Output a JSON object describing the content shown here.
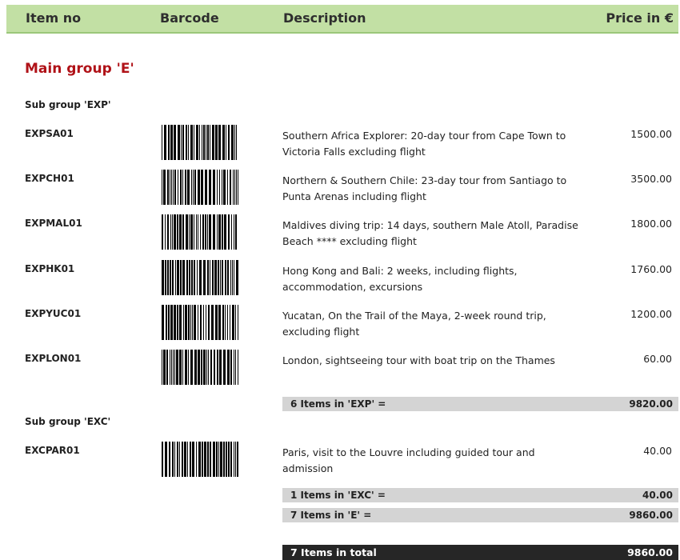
{
  "header": {
    "item_no": "Item no",
    "barcode": "Barcode",
    "description": "Description",
    "price": "Price in €"
  },
  "main_group": "Main group 'E'",
  "subgroups": [
    {
      "title": "Sub group 'EXP'",
      "items": [
        {
          "item_no": "EXPSA01",
          "description": "Southern Africa Explorer: 20-day tour from Cape Town to Victoria Falls excluding flight",
          "price": "1500.00"
        },
        {
          "item_no": "EXPCH01",
          "description": "Northern & Southern Chile: 23-day tour from Santiago to Punta Arenas including flight",
          "price": "3500.00"
        },
        {
          "item_no": "EXPMAL01",
          "description": "Maldives diving trip: 14 days, southern Male Atoll, Paradise Beach **** excluding flight",
          "price": "1800.00"
        },
        {
          "item_no": "EXPHK01",
          "description": "Hong Kong and Bali: 2 weeks, including flights, accommodation, excursions",
          "price": "1760.00"
        },
        {
          "item_no": "EXPYUC01",
          "description": "Yucatan, On the Trail of the Maya, 2-week round trip, excluding flight",
          "price": "1200.00"
        },
        {
          "item_no": "EXPLON01",
          "description": "London, sightseeing tour with boat trip on the Thames",
          "price": "60.00"
        }
      ],
      "summary_label": "6 Items in 'EXP' =",
      "summary_value": "9820.00"
    },
    {
      "title": "Sub group 'EXC'",
      "items": [
        {
          "item_no": "EXCPAR01",
          "description": "Paris, visit to the Louvre including guided tour and admission",
          "price": "40.00"
        }
      ],
      "summary_label": "1 Items in 'EXC' =",
      "summary_value": "40.00"
    }
  ],
  "group_summary": {
    "label": "7 Items in 'E' =",
    "value": "9860.00"
  },
  "total": {
    "label": "7 Items in total",
    "value": "9860.00"
  },
  "colors": {
    "header_bg": "#c2e0a4",
    "main_group_text": "#b01218",
    "summary_bg": "#d4d4d4",
    "total_bg": "#262626"
  }
}
